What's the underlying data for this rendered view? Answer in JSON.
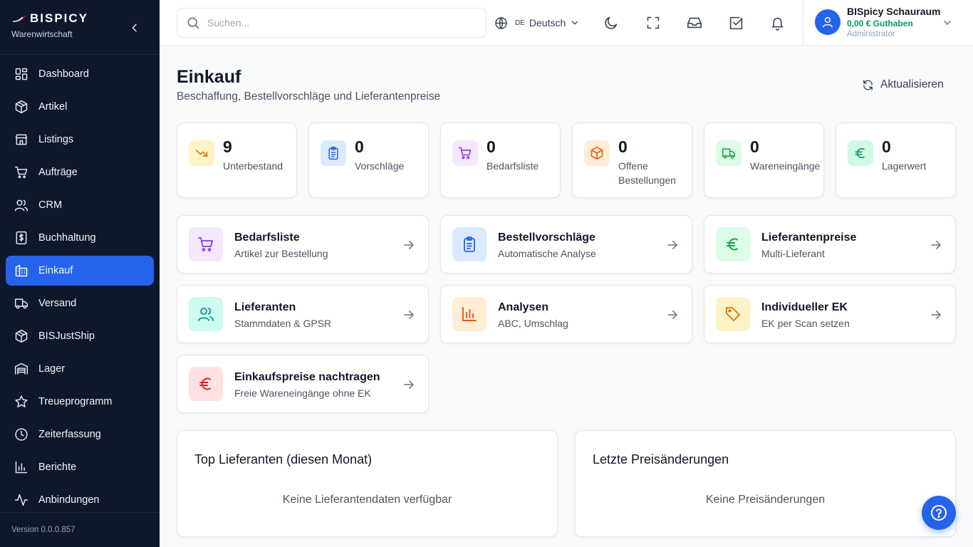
{
  "sidebar": {
    "brand_name": "BISPICY",
    "brand_sub": "Warenwirtschaft",
    "items": [
      {
        "label": "Dashboard",
        "icon": "dashboard-icon"
      },
      {
        "label": "Artikel",
        "icon": "package-icon"
      },
      {
        "label": "Listings",
        "icon": "store-icon"
      },
      {
        "label": "Aufträge",
        "icon": "cart-icon"
      },
      {
        "label": "CRM",
        "icon": "users-icon"
      },
      {
        "label": "Buchhaltung",
        "icon": "receipt-icon"
      },
      {
        "label": "Einkauf",
        "icon": "building-icon",
        "active": true
      },
      {
        "label": "Versand",
        "icon": "truck-icon"
      },
      {
        "label": "BISJustShip",
        "icon": "package-icon"
      },
      {
        "label": "Lager",
        "icon": "warehouse-icon"
      },
      {
        "label": "Treueprogramm",
        "icon": "star-icon"
      },
      {
        "label": "Zeiterfassung",
        "icon": "clock-icon"
      },
      {
        "label": "Berichte",
        "icon": "bar-chart-icon"
      },
      {
        "label": "Anbindungen",
        "icon": "activity-icon"
      }
    ],
    "version": "Version 0.0.0.857"
  },
  "topbar": {
    "search_placeholder": "Suchen...",
    "lang_code": "DE",
    "lang_label": "Deutsch",
    "user_name": "BISpicy Schauraum",
    "user_balance": "0,00 € Guthaben",
    "user_role": "Administrator"
  },
  "page": {
    "title": "Einkauf",
    "subtitle": "Beschaffung, Bestellvorschläge und Lieferantenpreise",
    "refresh_label": "Aktualisieren"
  },
  "stats": [
    {
      "value": "9",
      "label": "Unterbestand"
    },
    {
      "value": "0",
      "label": "Vorschläge"
    },
    {
      "value": "0",
      "label": "Bedarfsliste"
    },
    {
      "value": "0",
      "label": "Offene Bestellungen"
    },
    {
      "value": "0",
      "label": "Wareneingänge"
    },
    {
      "value": "0",
      "label": "Lagerwert"
    }
  ],
  "cards": [
    {
      "title": "Bedarfsliste",
      "sub": "Artikel zur Bestellung"
    },
    {
      "title": "Bestellvorschläge",
      "sub": "Automatische Analyse"
    },
    {
      "title": "Lieferantenpreise",
      "sub": "Multi-Lieferant"
    },
    {
      "title": "Lieferanten",
      "sub": "Stammdaten & GPSR"
    },
    {
      "title": "Analysen",
      "sub": "ABC, Umschlag"
    },
    {
      "title": "Individueller EK",
      "sub": "EK per Scan setzen"
    },
    {
      "title": "Einkaufspreise nachtragen",
      "sub": "Freie Wareneingänge ohne EK"
    }
  ],
  "panels": [
    {
      "title": "Top Lieferanten (diesen Monat)",
      "empty": "Keine Lieferantendaten verfügbar"
    },
    {
      "title": "Letzte Preisänderungen",
      "empty": "Keine Preisänderungen"
    }
  ],
  "colors": {
    "sidebar_bg": "#0f172a",
    "accent": "#2563eb",
    "balance_green": "#059669"
  }
}
